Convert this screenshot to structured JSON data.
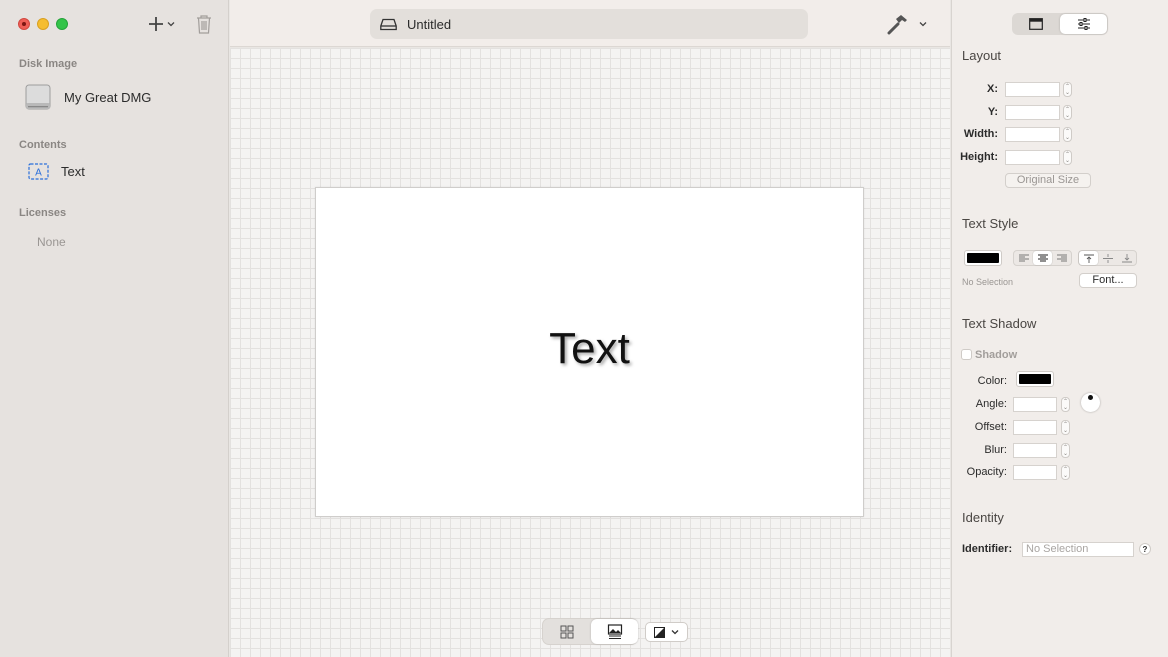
{
  "window": {
    "document_title": "Untitled"
  },
  "sidebar": {
    "disk_image_header": "Disk Image",
    "disk_image_name": "My Great DMG",
    "contents_header": "Contents",
    "contents_items": [
      {
        "label": "Text",
        "icon": "text-box-icon"
      }
    ],
    "licenses_header": "Licenses",
    "licenses_empty": "None"
  },
  "canvas": {
    "artboard_text": "Text"
  },
  "inspector": {
    "layout": {
      "title": "Layout",
      "x_label": "X:",
      "y_label": "Y:",
      "width_label": "Width:",
      "height_label": "Height:",
      "x_value": "",
      "y_value": "",
      "width_value": "",
      "height_value": "",
      "original_size_label": "Original Size"
    },
    "text_style": {
      "title": "Text Style",
      "color": "#000000",
      "selection_note": "No Selection",
      "font_button": "Font..."
    },
    "text_shadow": {
      "title": "Text Shadow",
      "shadow_label": "Shadow",
      "color_label": "Color:",
      "angle_label": "Angle:",
      "offset_label": "Offset:",
      "blur_label": "Blur:",
      "opacity_label": "Opacity:",
      "color": "#000000"
    },
    "identity": {
      "title": "Identity",
      "identifier_label": "Identifier:",
      "identifier_placeholder": "No Selection",
      "help_label": "?"
    }
  },
  "colors": {
    "close": "#ee5e55",
    "minimize": "#f5bd2f",
    "maximize": "#33c449",
    "accent": "#2a6fdb"
  }
}
